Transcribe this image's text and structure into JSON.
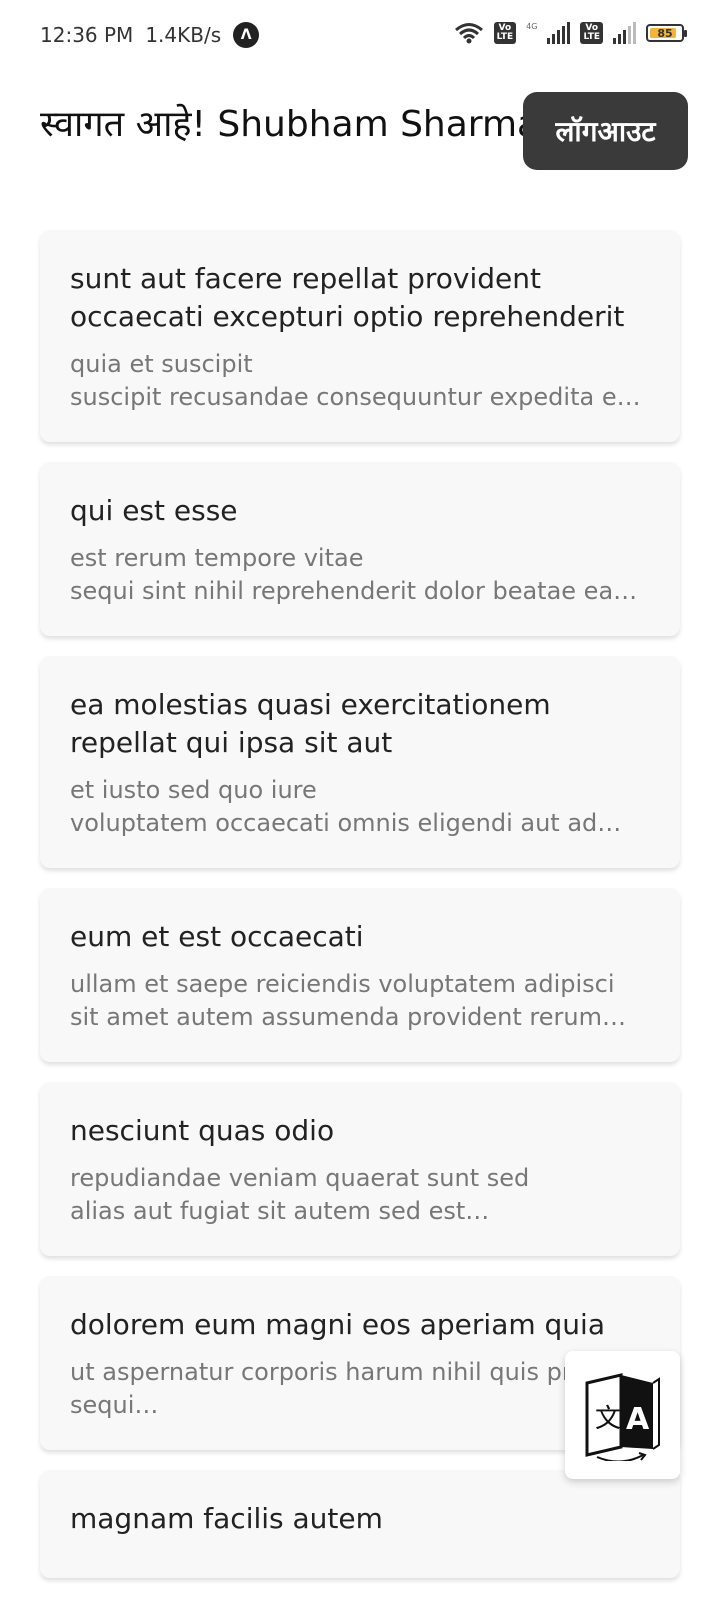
{
  "status_bar": {
    "time": "12:36 PM",
    "net_speed": "1.4KB/s",
    "app_icon": "lambda-icon",
    "network_gen": "4G",
    "volte_label": "Vo LTE",
    "battery_level": 85,
    "battery_label": "85"
  },
  "header": {
    "welcome_text": "स्वागत आहे! Shubham Sharma",
    "logout_label": "लॉगआउट"
  },
  "posts": [
    {
      "title": "sunt aut facere repellat provident occaecati excepturi optio reprehenderit",
      "body": "quia et suscipit\nsuscipit recusandae consequuntur expedita et …"
    },
    {
      "title": "qui est esse",
      "body": "est rerum tempore vitae\nsequi sint nihil reprehenderit dolor beatae ea d…"
    },
    {
      "title": "ea molestias quasi exercitationem repellat qui ipsa sit aut",
      "body": "et iusto sed quo iure\nvoluptatem occaecati omnis eligendi aut ad…"
    },
    {
      "title": "eum et est occaecati",
      "body": "ullam et saepe reiciendis voluptatem adipisci\nsit amet autem assumenda provident rerum cul…"
    },
    {
      "title": "nesciunt quas odio",
      "body": "repudiandae veniam quaerat sunt sed\nalias aut fugiat sit autem sed est…"
    },
    {
      "title": "dolorem eum magni eos aperiam quia",
      "body": "ut aspernatur corporis harum nihil quis pro\nsequi…"
    },
    {
      "title": "magnam facilis autem",
      "body": ""
    }
  ],
  "fab": {
    "icon": "translate-icon"
  },
  "colors": {
    "logout_bg": "#3a3a3a",
    "card_bg": "#f8f8f8",
    "battery_fill": "#f3b33d"
  }
}
